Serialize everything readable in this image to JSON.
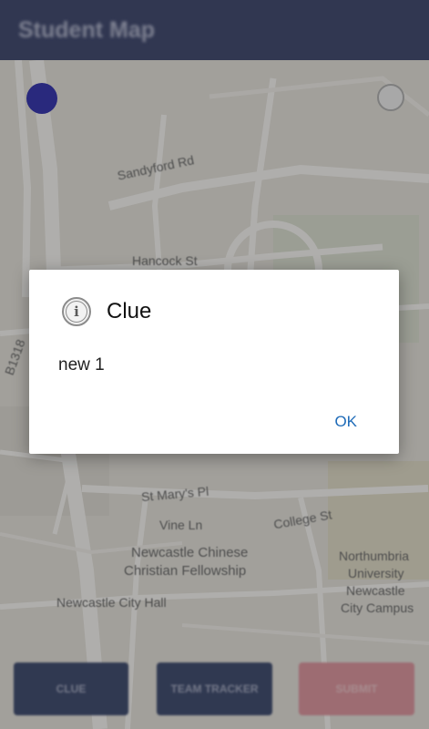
{
  "app_bar": {
    "title": "Student Map"
  },
  "map": {
    "labels": {
      "hancock": "Hancock St",
      "sandyford": "Sandyford Rd",
      "stmarys": "St Mary's Pl",
      "vine": "Vine Ln",
      "college": "College St",
      "b1318": "B1318",
      "newcastle_chinese": "Newcastle Chinese",
      "christian_fellowship": "Christian Fellowship",
      "city_hall": "Newcastle City Hall",
      "northumbria": "Northumbria",
      "university": "University",
      "newcastle_campus": "Newcastle",
      "city_campus": "City Campus"
    }
  },
  "bottom_buttons": {
    "clue": "CLUE",
    "team_tracker": "TEAM TRACKER",
    "third": "SUBMIT"
  },
  "dialog": {
    "title": "Clue",
    "message": "new 1",
    "ok": "OK",
    "icon": "info-icon"
  }
}
